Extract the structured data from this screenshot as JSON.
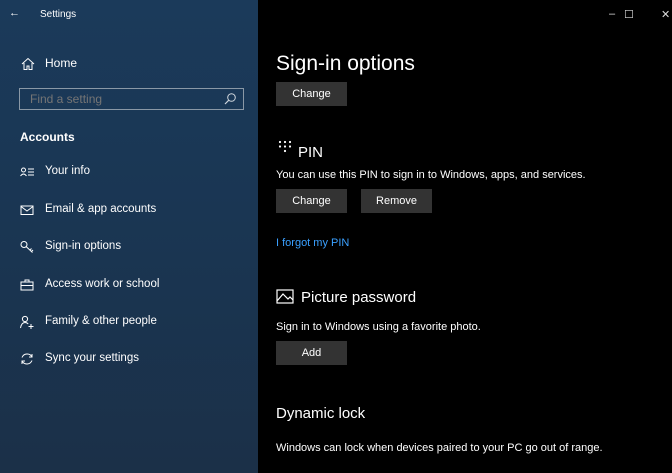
{
  "titlebar": {
    "back_glyph": "←",
    "title": "Settings",
    "minimize": "–",
    "maximize": "☐",
    "close": "✕"
  },
  "sidebar": {
    "home_label": "Home",
    "search_placeholder": "Find a setting",
    "section_title": "Accounts",
    "items": [
      {
        "label": "Your info",
        "icon": "person-card-icon"
      },
      {
        "label": "Email & app accounts",
        "icon": "mail-icon"
      },
      {
        "label": "Sign-in options",
        "icon": "key-icon"
      },
      {
        "label": "Access work or school",
        "icon": "briefcase-icon"
      },
      {
        "label": "Family & other people",
        "icon": "person-add-icon"
      },
      {
        "label": "Sync your settings",
        "icon": "sync-icon"
      }
    ]
  },
  "main": {
    "title": "Sign-in options",
    "change_label": "Change",
    "pin": {
      "heading": "PIN",
      "description": "You can use this PIN to sign in to Windows, apps, and services.",
      "change_label": "Change",
      "remove_label": "Remove",
      "forgot_link": "I forgot my PIN"
    },
    "picture_password": {
      "heading": "Picture password",
      "description": "Sign in to Windows using a favorite photo.",
      "add_label": "Add"
    },
    "dynamic_lock": {
      "heading": "Dynamic lock",
      "description": "Windows can lock when devices paired to your PC go out of range."
    }
  },
  "colors": {
    "sidebar_bg": "#1b3a5a",
    "main_bg": "#000000",
    "button_bg": "#333333",
    "link": "#3aa0ff"
  }
}
